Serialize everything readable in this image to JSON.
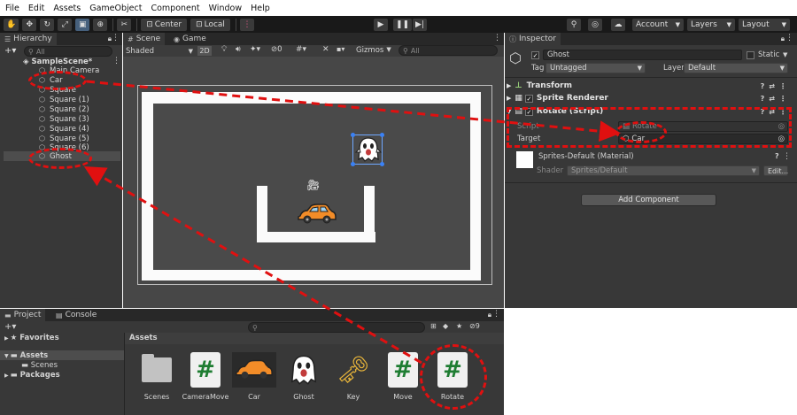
{
  "menu": [
    "File",
    "Edit",
    "Assets",
    "GameObject",
    "Component",
    "Window",
    "Help"
  ],
  "toolbar": {
    "pivot_label": "Center",
    "space_label": "Local",
    "account_label": "Account",
    "layers_label": "Layers",
    "layout_label": "Layout"
  },
  "hierarchy": {
    "tab_label": "Hierarchy",
    "search_placeholder": "All",
    "scene_name": "SampleScene*",
    "items": [
      "Main Camera",
      "Car",
      "Square",
      "Square (1)",
      "Square (2)",
      "Square (3)",
      "Square (4)",
      "Square (5)",
      "Square (6)",
      "Ghost"
    ]
  },
  "scene": {
    "tab_scene": "Scene",
    "tab_game": "Game",
    "shading_label": "Shaded",
    "mode_2d": "2D",
    "fx_count": "0",
    "gizmos_label": "Gizmos",
    "search_placeholder": "All"
  },
  "inspector": {
    "tab_label": "Inspector",
    "object_name": "Ghost",
    "static_label": "Static",
    "tag_label": "Tag",
    "tag_value": "Untagged",
    "layer_label": "Layer",
    "layer_value": "Default",
    "components": [
      "Transform",
      "Sprite Renderer",
      "Rotate (Script)"
    ],
    "script_label": "Script",
    "script_value": "Rotate",
    "target_label": "Target",
    "target_value": "Car",
    "material_name": "Sprites-Default (Material)",
    "shader_label": "Shader",
    "shader_value": "Sprites/Default",
    "edit_label": "Edit...",
    "add_component_label": "Add Component"
  },
  "project": {
    "tab_project": "Project",
    "tab_console": "Console",
    "favorites_label": "Favorites",
    "assets_label": "Assets",
    "scenes_folder": "Scenes",
    "packages_label": "Packages",
    "breadcrumb": "Assets",
    "hidden_count": "9",
    "assets": [
      "Scenes",
      "CameraMove",
      "Car",
      "Ghost",
      "Key",
      "Move",
      "Rotate"
    ]
  },
  "colors": {
    "annotation_red": "#e01010",
    "unity_panel": "#383838",
    "unity_dark": "#191919",
    "script_hash_green": "#1e7d32"
  }
}
